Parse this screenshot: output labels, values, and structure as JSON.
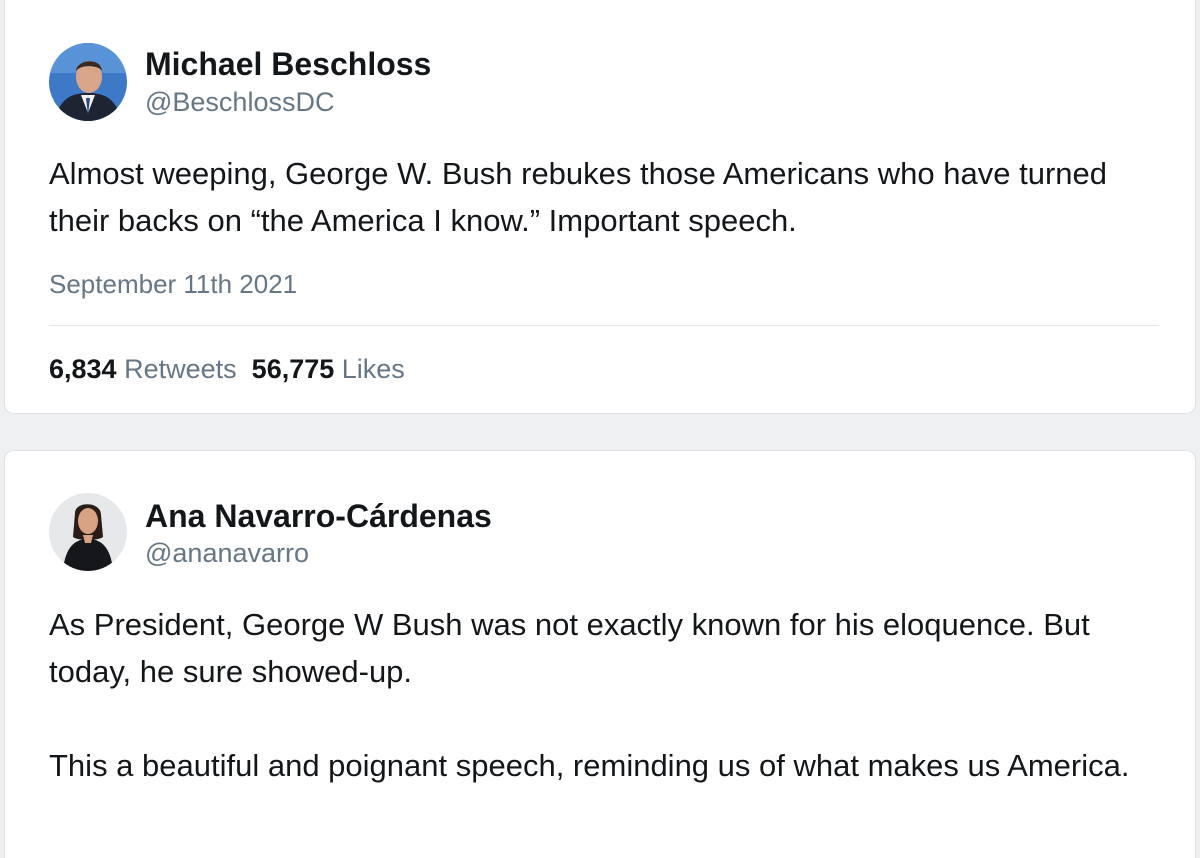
{
  "tweets": [
    {
      "author": "Michael Beschloss",
      "handle": "@BeschlossDC",
      "text": "Almost weeping, George W. Bush rebukes those Americans who have turned their backs on “the America I know.”  Important speech.",
      "date": "September 11th 2021",
      "retweets_count": "6,834",
      "retweets_label": "Retweets",
      "likes_count": "56,775",
      "likes_label": "Likes"
    },
    {
      "author": "Ana Navarro-Cárdenas",
      "handle": "@ananavarro",
      "text": "As President, George W Bush was not exactly known for his eloquence. But today, he sure showed-up.\n\nThis a beautiful and poignant speech, reminding us of what makes us America."
    }
  ],
  "colors": {
    "text": "#14171a",
    "secondary": "#657786",
    "border": "#dfe3e7",
    "background": "#eef0f2"
  }
}
